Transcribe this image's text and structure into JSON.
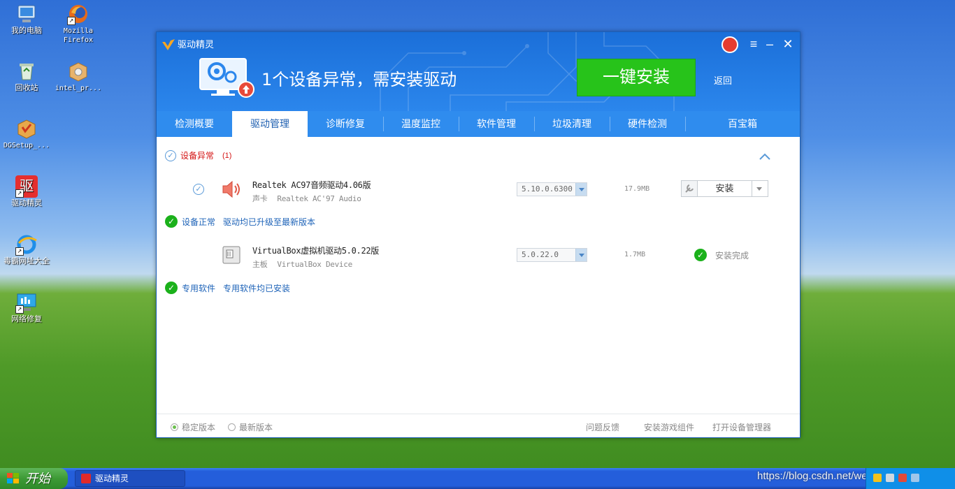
{
  "desktop": {
    "icons": [
      {
        "label": "我的电脑"
      },
      {
        "label": "Mozilla\nFirefox"
      },
      {
        "label": "回收站"
      },
      {
        "label": "intel_pr..."
      },
      {
        "label": "DGSetup_..."
      },
      {
        "label": "驱动精灵"
      },
      {
        "label": "毒霸网址大全"
      },
      {
        "label": "网络修复"
      }
    ]
  },
  "window": {
    "title": "驱动精灵",
    "hero_text": "1个设备异常，需安装驱动",
    "install_all_label": "一键安装",
    "back_label": "返回",
    "tabs": [
      {
        "label": "检测概要"
      },
      {
        "label": "驱动管理",
        "active": true
      },
      {
        "label": "诊断修复"
      },
      {
        "label": "温度监控"
      },
      {
        "label": "软件管理"
      },
      {
        "label": "垃圾清理"
      },
      {
        "label": "硬件检测"
      },
      {
        "label": "百宝箱"
      }
    ]
  },
  "sections": {
    "abnormal": {
      "title": "设备异常",
      "count": "(1)",
      "devices": [
        {
          "name": "Realtek AC97音频驱动4.06版",
          "category": "声卡",
          "device": "Realtek AC'97 Audio",
          "version": "5.10.0.6300",
          "size": "17.9MB",
          "action_label": "安装",
          "icon": "speaker-icon"
        }
      ]
    },
    "normal": {
      "title": "设备正常",
      "note": "驱动均已升级至最新版本",
      "devices": [
        {
          "name": "VirtualBox虚拟机驱动5.0.22版",
          "category": "主板",
          "device": "VirtualBox Device",
          "version": "5.0.22.0",
          "size": "1.7MB",
          "status": "安装完成",
          "icon": "motherboard-icon"
        }
      ]
    },
    "software": {
      "title": "专用软件",
      "note": "专用软件均已安装"
    }
  },
  "footer": {
    "stable_label": "稳定版本",
    "latest_label": "最新版本",
    "feedback_label": "问题反馈",
    "game_components_label": "安装游戏组件",
    "device_manager_label": "打开设备管理器"
  },
  "taskbar": {
    "start_label": "开始",
    "task_item_label": "驱动精灵",
    "watermark": "https://blog.csdn.net/weixin_41039168"
  },
  "colors": {
    "header_blue": "#1b6fd9",
    "tab_blue": "#2f8cee",
    "install_green": "#27c31a",
    "alert_red": "#d41414",
    "link_blue": "#1e63b8"
  }
}
